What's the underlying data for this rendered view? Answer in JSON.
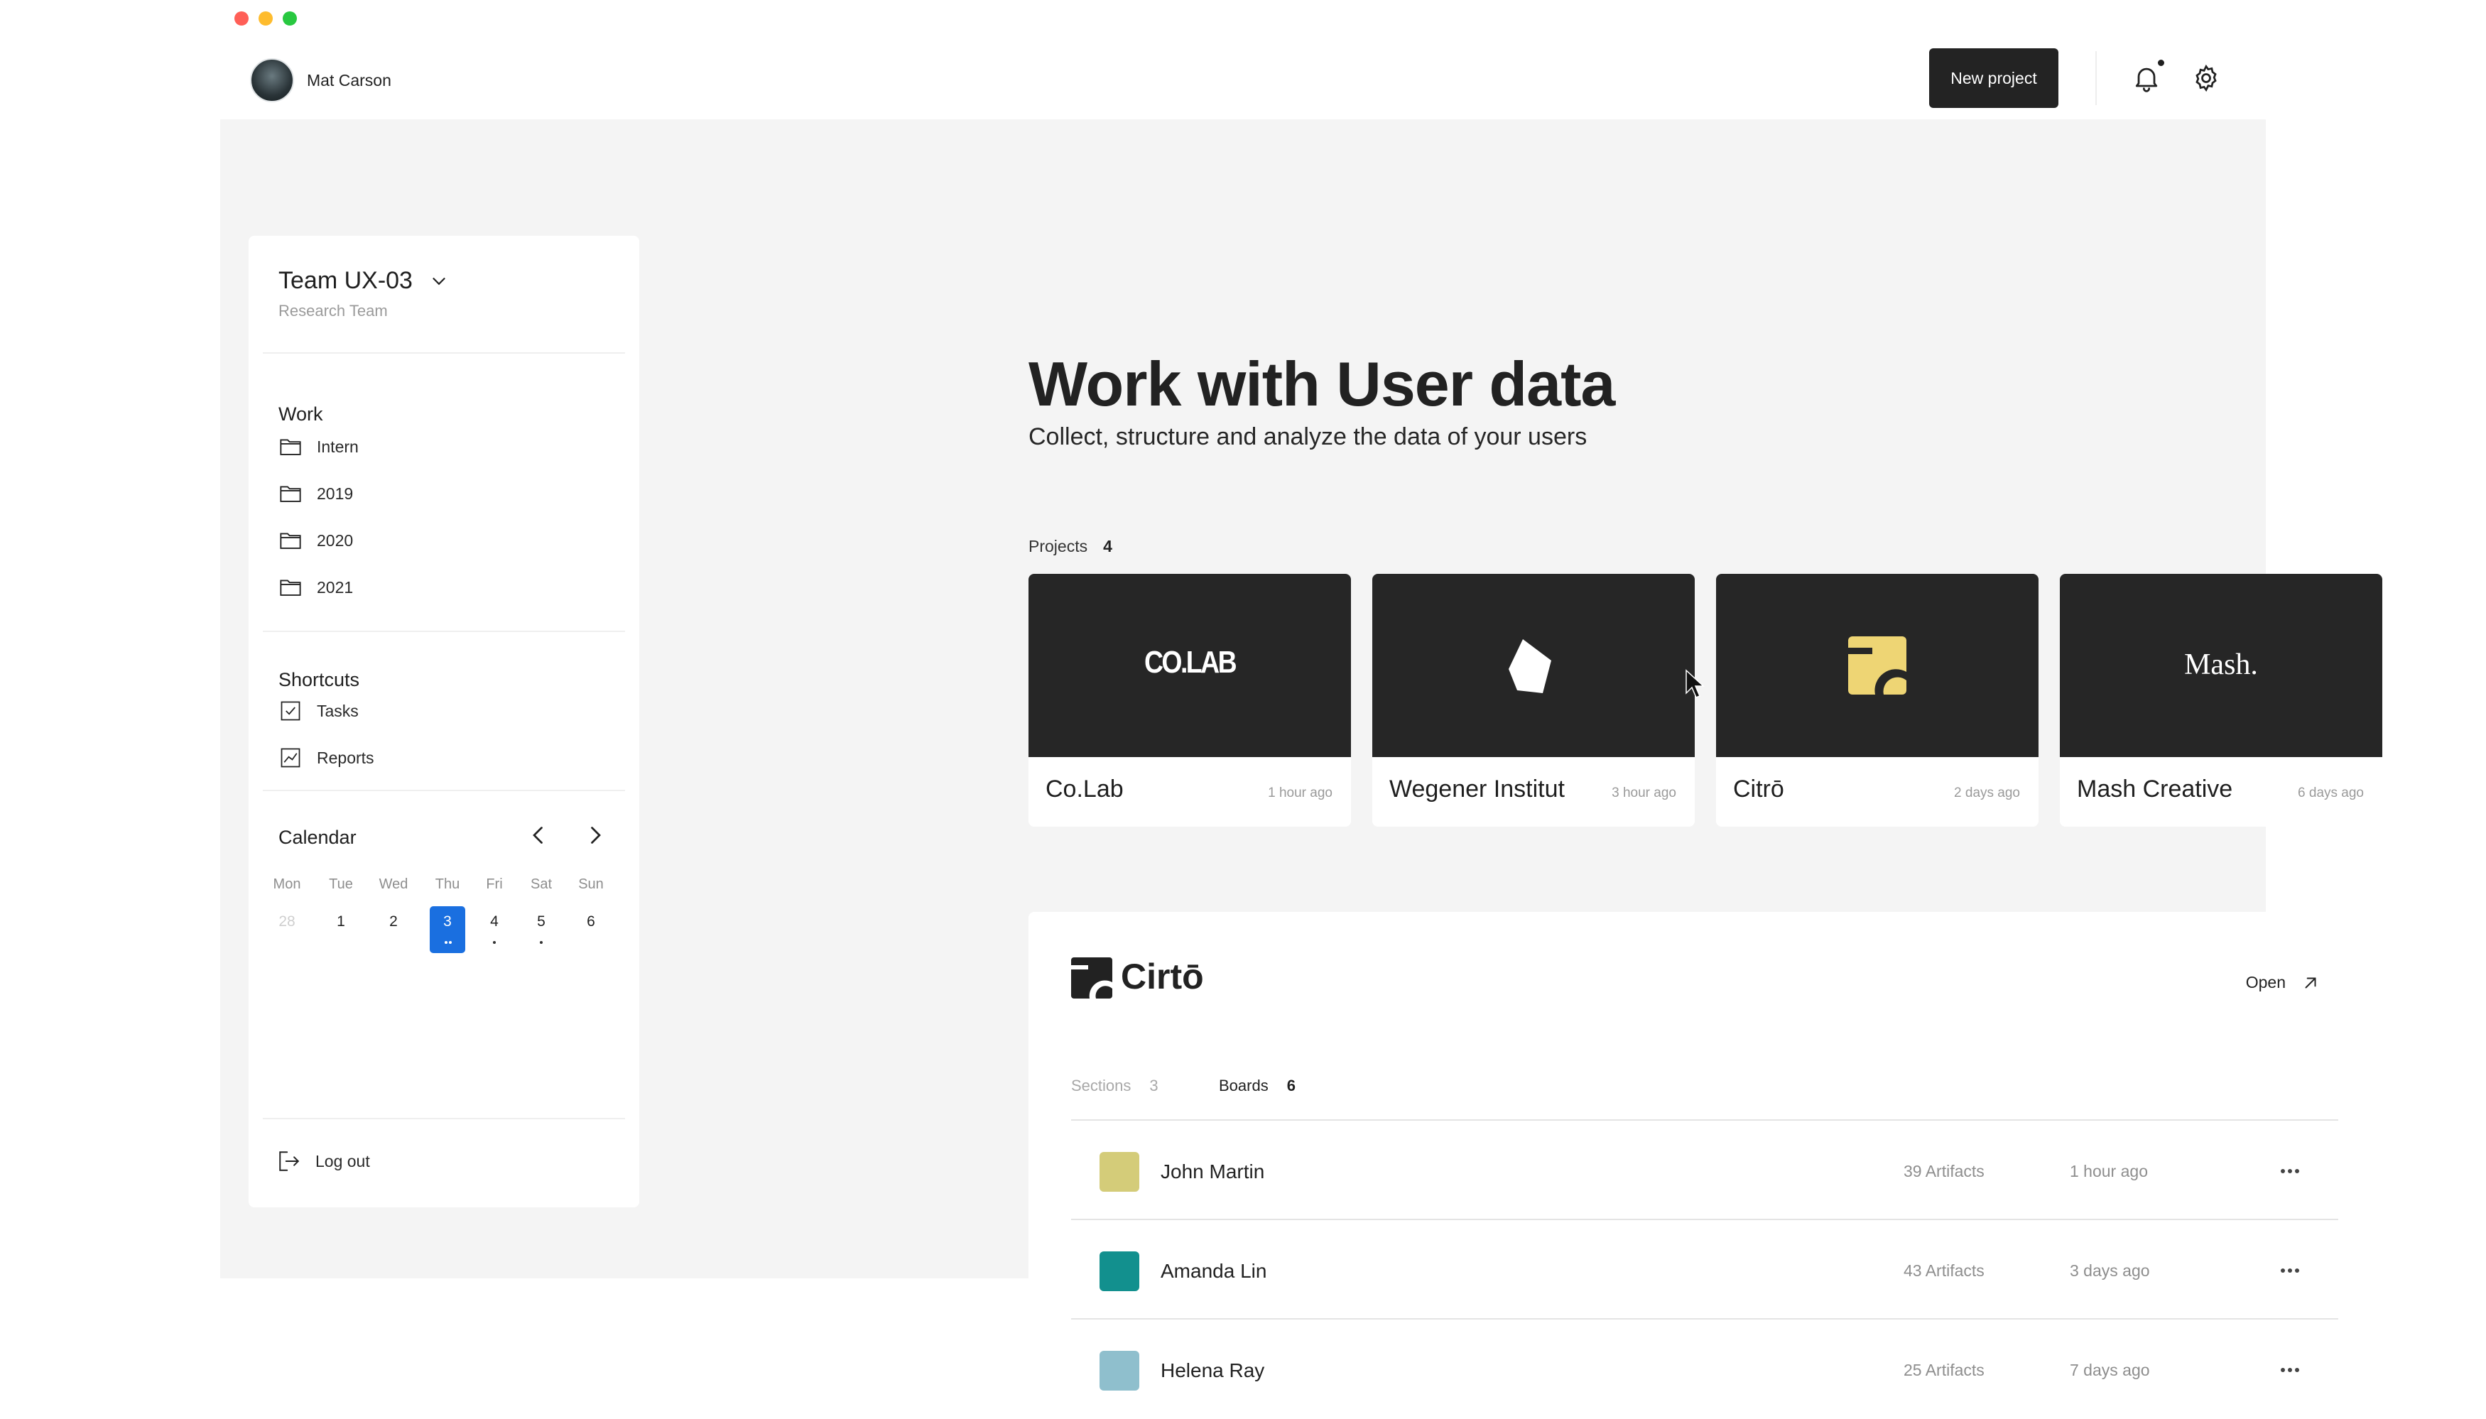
{
  "window": {
    "controls": [
      "close",
      "minimize",
      "maximize"
    ]
  },
  "topbar": {
    "user_name": "Mat Carson",
    "new_project_label": "New project",
    "icons": {
      "notifications": "bell-icon",
      "settings": "gear-icon"
    }
  },
  "sidebar": {
    "team_name": "Team UX-03",
    "team_subtitle": "Research Team",
    "work_title": "Work",
    "work_items": [
      {
        "label": "Intern",
        "icon": "folder-icon"
      },
      {
        "label": "2019",
        "icon": "folder-icon"
      },
      {
        "label": "2020",
        "icon": "folder-icon"
      },
      {
        "label": "2021",
        "icon": "folder-icon"
      }
    ],
    "shortcuts_title": "Shortcuts",
    "shortcut_items": [
      {
        "label": "Tasks",
        "icon": "checkbox-icon"
      },
      {
        "label": "Reports",
        "icon": "chart-icon"
      }
    ],
    "calendar": {
      "title": "Calendar",
      "weekdays": [
        "Mon",
        "Tue",
        "Wed",
        "Thu",
        "Fri",
        "Sat",
        "Sun"
      ],
      "days": [
        "28",
        "1",
        "2",
        "3",
        "4",
        "5",
        "6"
      ],
      "selected_day": "3",
      "accent_color": "#1a6fe0"
    },
    "logout_label": "Log out"
  },
  "hero": {
    "title": "Work with User data",
    "subtitle": "Collect, structure and analyze the data of your users"
  },
  "projects": {
    "label": "Projects",
    "count": "4",
    "cards": [
      {
        "name": "Co.Lab",
        "time": "1 hour ago",
        "logo_text": "CO.LAB"
      },
      {
        "name": "Wegener Institut",
        "time": "3 hour ago"
      },
      {
        "name": "Citrō",
        "time": "2 days ago"
      },
      {
        "name": "Mash Creative",
        "time": "6 days ago",
        "logo_text": "Mash."
      }
    ]
  },
  "detail": {
    "title": "Cirtō",
    "open_label": "Open",
    "tabs": [
      {
        "label": "Sections",
        "count": "3"
      },
      {
        "label": "Boards",
        "count": "6"
      }
    ],
    "rows": [
      {
        "name": "John Martin",
        "artifacts": "39 Artifacts",
        "time": "1 hour ago",
        "color": "#d4cc79"
      },
      {
        "name": "Amanda Lin",
        "artifacts": "43 Artifacts",
        "time": "3 days ago",
        "color": "#12908e"
      },
      {
        "name": "Helena Ray",
        "artifacts": "25 Artifacts",
        "time": "7 days ago",
        "color": "#8fbfcd"
      }
    ]
  }
}
